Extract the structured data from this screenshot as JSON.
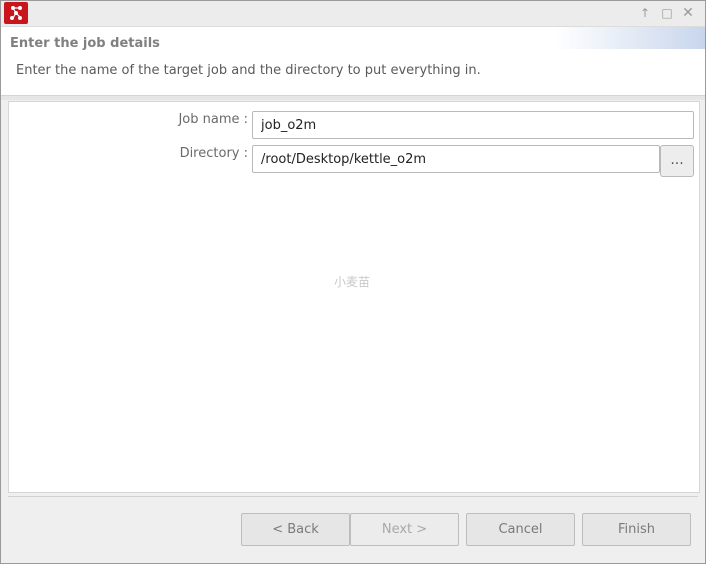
{
  "window": {
    "app_icon": "kettle-network-icon",
    "controls": [
      {
        "name": "maximize-arrow-icon",
        "glyph": "↑"
      },
      {
        "name": "restore-icon",
        "glyph": "□"
      },
      {
        "name": "close-icon",
        "glyph": "✕"
      }
    ]
  },
  "header": {
    "title": "Enter the job details",
    "description": "Enter the name of the target job and the directory to put everything in."
  },
  "form": {
    "job_name_label": "Job name :",
    "job_name_value": "job_o2m",
    "directory_label": "Directory :",
    "directory_value": "/root/Desktop/kettle_o2m",
    "browse_label": "..."
  },
  "watermark": "小麦苗",
  "buttons": {
    "back": "< Back",
    "next": "Next >",
    "cancel": "Cancel",
    "finish": "Finish"
  },
  "colors": {
    "app_icon_bg": "#c8161c",
    "banner_accent": "#c8d6ec"
  }
}
